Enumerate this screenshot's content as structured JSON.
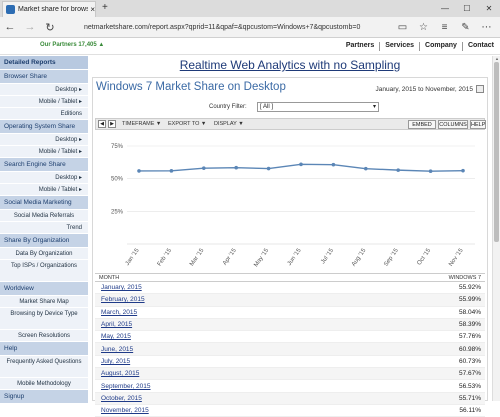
{
  "browser": {
    "tab_title": "Market share for browsers",
    "tab_close": "×",
    "new_tab": "+",
    "address": "netmarketshare.com/report.aspx?qprid=11&qpaf=&qpcustom=Windows+7&qpcustomb=0",
    "win_controls": [
      "—",
      "☐",
      "✕"
    ],
    "nav_icons": [
      "back-icon",
      "forward-icon",
      "refresh-icon"
    ],
    "right_icons": [
      "reading-view-icon",
      "favorites-icon",
      "hub-icon",
      "notes-icon",
      "more-icon"
    ]
  },
  "site": {
    "partners": "Our Partners 17,405 ▲",
    "nav": [
      "Partners",
      "Services",
      "Company",
      "Contact"
    ],
    "tagline": "Realtime Web Analytics with no Sampling"
  },
  "sidebar": [
    {
      "type": "head",
      "label": "Detailed Reports"
    },
    {
      "type": "head",
      "label": "Browser Share"
    },
    {
      "type": "item",
      "label": "Desktop ▸"
    },
    {
      "type": "item",
      "label": "Mobile / Tablet ▸"
    },
    {
      "type": "item",
      "label": "Editions"
    },
    {
      "type": "head",
      "label": "Operating System Share"
    },
    {
      "type": "item",
      "label": "Desktop ▸"
    },
    {
      "type": "item",
      "label": "Mobile / Tablet ▸"
    },
    {
      "type": "head",
      "label": "Search Engine Share"
    },
    {
      "type": "item",
      "label": "Desktop ▸"
    },
    {
      "type": "item",
      "label": "Mobile / Tablet ▸"
    },
    {
      "type": "head",
      "label": "Social Media Marketing"
    },
    {
      "type": "item",
      "label": "Social Media Referrals"
    },
    {
      "type": "item",
      "label": "Trend"
    },
    {
      "type": "head",
      "label": "Share By Organization"
    },
    {
      "type": "item",
      "label": "Data By Organization"
    },
    {
      "type": "item",
      "label": "Top ISPs / Organizations"
    },
    {
      "type": "head",
      "label": "Worldview"
    },
    {
      "type": "item",
      "label": "Market Share Map"
    },
    {
      "type": "item",
      "label": "Browsing by Device Type"
    },
    {
      "type": "item",
      "label": "Screen Resolutions"
    },
    {
      "type": "head",
      "label": "Help"
    },
    {
      "type": "item",
      "label": "Frequently Asked Questions"
    },
    {
      "type": "item",
      "label": "Mobile Methodology"
    },
    {
      "type": "head",
      "label": "Signup"
    }
  ],
  "report": {
    "title": "Windows 7 Market Share on Desktop",
    "date_range": "January, 2015 to November, 2015",
    "filter_label": "Country Filter:",
    "filter_value": "[ All ]",
    "toolbar": {
      "timeframe": "TIMEFRAME ▼",
      "export": "EXPORT TO ▼",
      "display": "DISPLAY ▼",
      "embed": "EMBED",
      "columns": "COLUMNS",
      "help": "HELP"
    },
    "table": {
      "col_month": "MONTH",
      "col_value": "WINDOWS 7",
      "rows": [
        {
          "month": "January, 2015",
          "value": "55.92%"
        },
        {
          "month": "February, 2015",
          "value": "55.99%"
        },
        {
          "month": "March, 2015",
          "value": "58.04%"
        },
        {
          "month": "April, 2015",
          "value": "58.39%"
        },
        {
          "month": "May, 2015",
          "value": "57.76%"
        },
        {
          "month": "June, 2015",
          "value": "60.98%"
        },
        {
          "month": "July, 2015",
          "value": "60.73%"
        },
        {
          "month": "August, 2015",
          "value": "57.67%"
        },
        {
          "month": "September, 2015",
          "value": "56.53%"
        },
        {
          "month": "October, 2015",
          "value": "55.71%"
        },
        {
          "month": "November, 2015",
          "value": "56.11%"
        }
      ]
    }
  },
  "chart_data": {
    "type": "line",
    "categories": [
      "Jan '15",
      "Feb '15",
      "Mar '15",
      "Apr '15",
      "May '15",
      "Jun '15",
      "Jul '15",
      "Aug '15",
      "Sep '15",
      "Oct '15",
      "Nov '15"
    ],
    "values": [
      55.92,
      55.99,
      58.04,
      58.39,
      57.76,
      60.98,
      60.73,
      57.67,
      56.53,
      55.71,
      56.11
    ],
    "y_ticks": [
      "75%",
      "50%",
      "25%"
    ],
    "y_tick_values": [
      75,
      50,
      25
    ],
    "ylim": [
      0,
      75
    ],
    "grid": true,
    "line_color": "#5b86b6"
  }
}
